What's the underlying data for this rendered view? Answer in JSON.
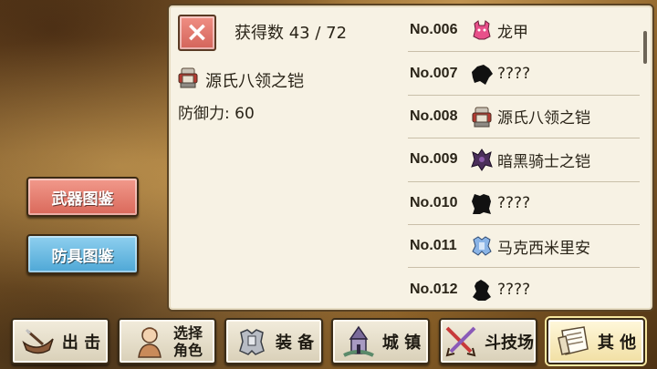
{
  "side_buttons": {
    "weapon_label": "武器图鉴",
    "armor_label": "防具图鉴"
  },
  "panel": {
    "close_icon": "×",
    "count_text": "获得数  43 / 72",
    "detail": {
      "item_name": "源氏八领之铠",
      "defense_text": "防御力: 60"
    },
    "list": [
      {
        "no": "No.006",
        "icon": "pink-dragon-armor-icon",
        "name": "龙甲"
      },
      {
        "no": "No.007",
        "icon": "unknown-silhouette-icon",
        "name": "????"
      },
      {
        "no": "No.008",
        "icon": "samurai-armor-icon",
        "name": "源氏八领之铠"
      },
      {
        "no": "No.009",
        "icon": "dark-knight-armor-icon",
        "name": "暗黑骑士之铠"
      },
      {
        "no": "No.010",
        "icon": "unknown-silhouette-icon",
        "name": "????"
      },
      {
        "no": "No.011",
        "icon": "blue-armor-icon",
        "name": "马克西米里安"
      },
      {
        "no": "No.012",
        "icon": "unknown-silhouette-icon",
        "name": "????"
      }
    ]
  },
  "nav": {
    "sortie": "出 击",
    "select_line1": "选择",
    "select_line2": "角色",
    "equip": "装 备",
    "town": "城 镇",
    "arena": "斗技场",
    "other": "其 他"
  },
  "colors": {
    "weapon_button": "#e07a6c",
    "armor_button": "#63b4df",
    "close_button": "#e07a6c",
    "panel_bg": "#f7f2e4"
  }
}
